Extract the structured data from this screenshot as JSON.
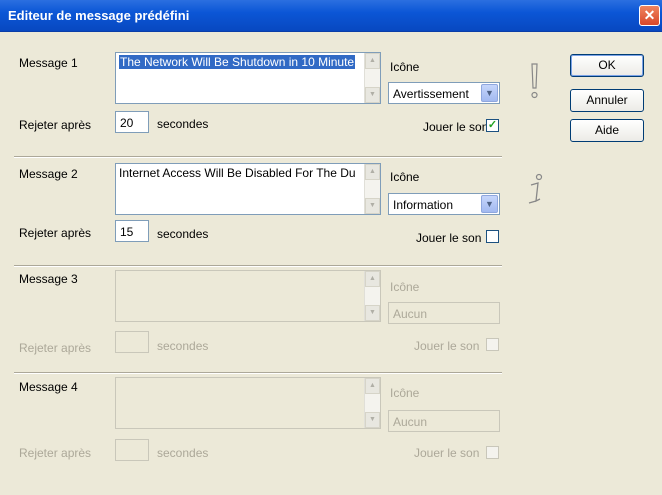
{
  "window": {
    "title": "Editeur de message prédéfini"
  },
  "buttons": {
    "ok": "OK",
    "cancel": "Annuler",
    "help": "Aide"
  },
  "labels": {
    "icon": "Icône",
    "reject_after": "Rejeter après",
    "seconds": "secondes",
    "play_sound": "Jouer le son"
  },
  "messages": [
    {
      "label": "Message 1",
      "text": "The Network Will Be Shutdown in 10 Minute",
      "seconds": "20",
      "icon": "Avertissement",
      "sound": true,
      "enabled": true,
      "icon_glyph": "exclamation-icon"
    },
    {
      "label": "Message 2",
      "text": "Internet Access Will Be Disabled For The Du",
      "seconds": "15",
      "icon": "Information",
      "sound": false,
      "enabled": true,
      "icon_glyph": "information-icon"
    },
    {
      "label": "Message 3",
      "text": "",
      "seconds": "",
      "icon": "Aucun",
      "sound": false,
      "enabled": false
    },
    {
      "label": "Message 4",
      "text": "",
      "seconds": "",
      "icon": "Aucun",
      "sound": false,
      "enabled": false
    }
  ]
}
